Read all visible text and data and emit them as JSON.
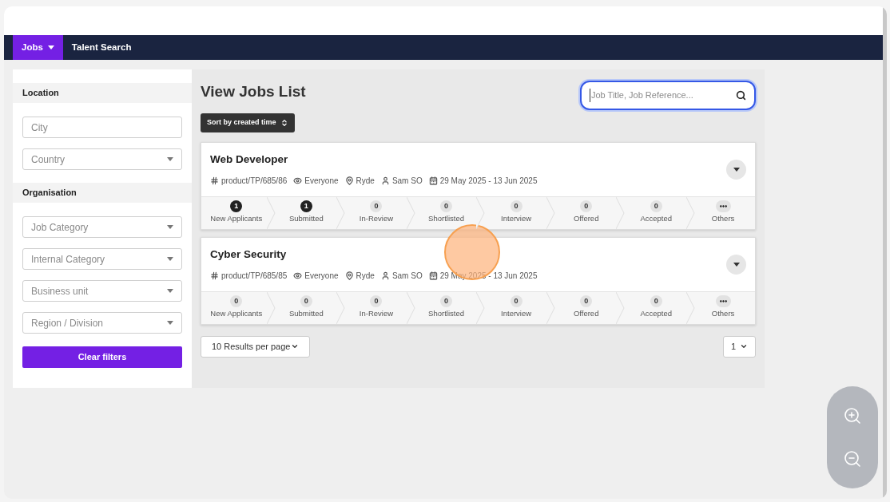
{
  "nav": {
    "items": [
      {
        "label": "Jobs",
        "selected": true,
        "dropdown": true
      },
      {
        "label": "Talent Search",
        "selected": false,
        "dropdown": false
      }
    ]
  },
  "filters": {
    "sections": [
      {
        "title": "Location",
        "fields": [
          {
            "placeholder": "City",
            "kind": "text"
          },
          {
            "placeholder": "Country",
            "kind": "select"
          }
        ]
      },
      {
        "title": "Organisation",
        "fields": [
          {
            "placeholder": "Job Category",
            "kind": "select"
          },
          {
            "placeholder": "Internal Category",
            "kind": "select"
          },
          {
            "placeholder": "Business unit",
            "kind": "select"
          },
          {
            "placeholder": "Region / Division",
            "kind": "select"
          }
        ]
      }
    ],
    "clear_button": "Clear filters"
  },
  "main": {
    "title": "View Jobs List",
    "search": {
      "placeholder": "Job Title, Job Reference..."
    },
    "sort_button": "Sort by created time",
    "jobs": [
      {
        "title": "Web Developer",
        "reference": "product/TP/685/86",
        "visibility": "Everyone",
        "location": "Ryde",
        "owner": "Sam SO",
        "dates": "29 May 2025 - 13 Jun 2025",
        "stages": [
          {
            "count": "1",
            "label": "New Applicants",
            "active": true
          },
          {
            "count": "1",
            "label": "Submitted",
            "active": true
          },
          {
            "count": "0",
            "label": "In-Review",
            "active": false
          },
          {
            "count": "0",
            "label": "Shortlisted",
            "active": false
          },
          {
            "count": "0",
            "label": "Interview",
            "active": false
          },
          {
            "count": "0",
            "label": "Offered",
            "active": false
          },
          {
            "count": "0",
            "label": "Accepted",
            "active": false
          }
        ],
        "others": "Others"
      },
      {
        "title": "Cyber Security",
        "reference": "product/TP/685/85",
        "visibility": "Everyone",
        "location": "Ryde",
        "owner": "Sam SO",
        "dates": "29 May 2025 - 13 Jun 2025",
        "stages": [
          {
            "count": "0",
            "label": "New Applicants",
            "active": false
          },
          {
            "count": "0",
            "label": "Submitted",
            "active": false
          },
          {
            "count": "0",
            "label": "In-Review",
            "active": false
          },
          {
            "count": "0",
            "label": "Shortlisted",
            "active": false
          },
          {
            "count": "0",
            "label": "Interview",
            "active": false
          },
          {
            "count": "0",
            "label": "Offered",
            "active": false
          },
          {
            "count": "0",
            "label": "Accepted",
            "active": false
          }
        ],
        "others": "Others"
      }
    ],
    "per_page": "10 Results per page",
    "page": "1"
  }
}
